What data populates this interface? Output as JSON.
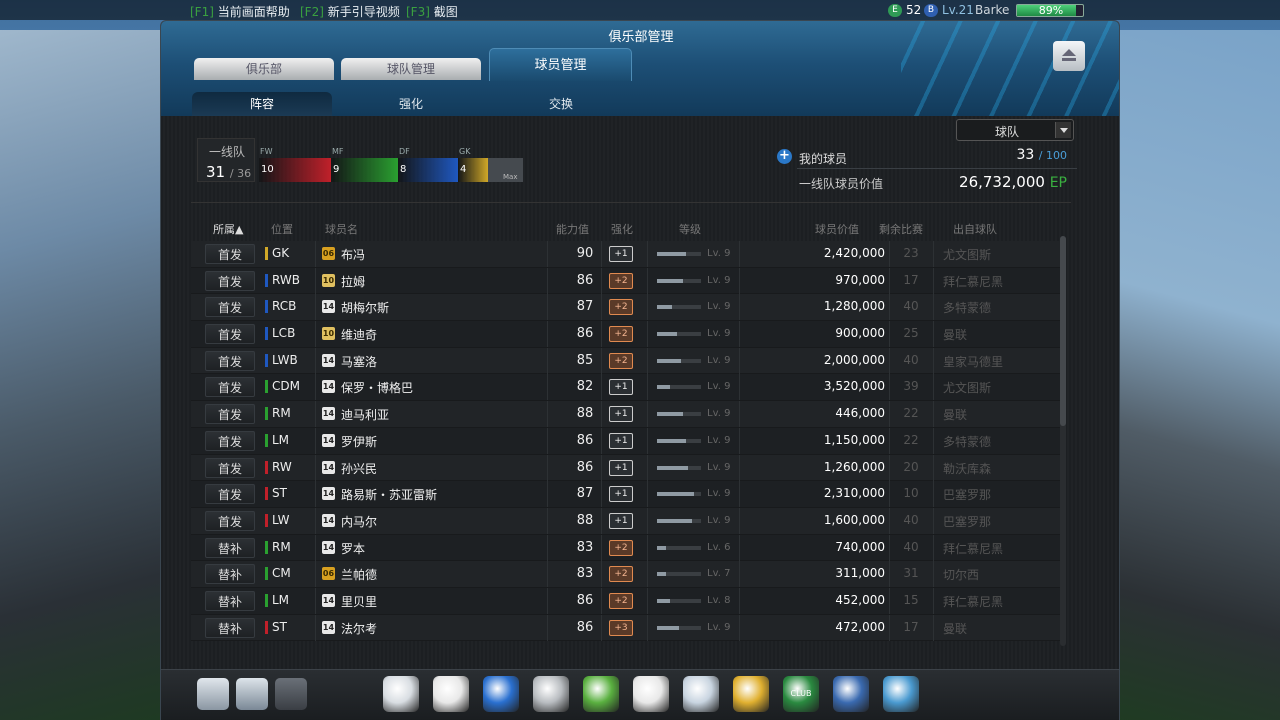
{
  "topbar": {
    "hotkeys": [
      {
        "key": "[F1]",
        "label": "当前画面帮助"
      },
      {
        "key": "[F2]",
        "label": "新手引导视频"
      },
      {
        "key": "[F3]",
        "label": "截图"
      }
    ],
    "coins": "52",
    "level": "Lv.21",
    "username": "Barke",
    "battery": "89%",
    "battery_fraction": 0.89,
    "coin_icon_letter": "E",
    "badge_icon_letter": "B"
  },
  "window": {
    "title": "俱乐部管理",
    "tabs": [
      "俱乐部",
      "球队管理",
      "球员管理"
    ],
    "active_tab": "球员管理",
    "subtabs": [
      "阵容",
      "强化",
      "交换"
    ]
  },
  "filter": {
    "selected": "球队"
  },
  "squad": {
    "label": "一线队",
    "count": "31",
    "total": "/ 36",
    "positions": [
      {
        "name": "FW",
        "count": "10",
        "color": "#c0202a"
      },
      {
        "name": "MF",
        "count": "9",
        "color": "#2aa030"
      },
      {
        "name": "DF",
        "count": "8",
        "color": "#1f58c0"
      },
      {
        "name": "GK",
        "count": "4",
        "color": "#d0a828"
      }
    ],
    "max_label": "Max"
  },
  "my_players": {
    "label": "我的球员",
    "count": "33",
    "capacity": "/ 100",
    "value_label": "一线队球员价值",
    "value": "26,732,000",
    "currency": "EP"
  },
  "table": {
    "headers": {
      "affiliation": "所属▲",
      "position": "位置",
      "name": "球员名",
      "ability": "能力值",
      "enhance": "强化",
      "grade": "等级",
      "value": "球员价值",
      "remaining": "剩余比赛",
      "club": "出自球队"
    },
    "rows": [
      {
        "status": "首发",
        "pos": "GK",
        "color": "#d0a828",
        "season": "06",
        "name": "布冯",
        "ability": "90",
        "enh": "+1",
        "lvl": "Lv. 9",
        "lvp": 0.65,
        "price": "2,420,000",
        "remaining": "23",
        "club": "尤文图斯"
      },
      {
        "status": "首发",
        "pos": "RWB",
        "color": "#1f58c0",
        "season": "10",
        "name": "拉姆",
        "ability": "86",
        "enh": "+2",
        "lvl": "Lv. 9",
        "lvp": 0.6,
        "price": "970,000",
        "remaining": "17",
        "club": "拜仁慕尼黑"
      },
      {
        "status": "首发",
        "pos": "RCB",
        "color": "#1f58c0",
        "season": "14",
        "name": "胡梅尔斯",
        "ability": "87",
        "enh": "+2",
        "lvl": "Lv. 9",
        "lvp": 0.35,
        "price": "1,280,000",
        "remaining": "40",
        "club": "多特蒙德"
      },
      {
        "status": "首发",
        "pos": "LCB",
        "color": "#1f58c0",
        "season": "10",
        "name": "维迪奇",
        "ability": "86",
        "enh": "+2",
        "lvl": "Lv. 9",
        "lvp": 0.45,
        "price": "900,000",
        "remaining": "25",
        "club": "曼联"
      },
      {
        "status": "首发",
        "pos": "LWB",
        "color": "#1f58c0",
        "season": "14",
        "name": "马塞洛",
        "ability": "85",
        "enh": "+2",
        "lvl": "Lv. 9",
        "lvp": 0.55,
        "price": "2,000,000",
        "remaining": "40",
        "club": "皇家马德里"
      },
      {
        "status": "首发",
        "pos": "CDM",
        "color": "#2aa030",
        "season": "14",
        "name": "保罗・博格巴",
        "ability": "82",
        "enh": "+1",
        "lvl": "Lv. 9",
        "lvp": 0.3,
        "price": "3,520,000",
        "remaining": "39",
        "club": "尤文图斯"
      },
      {
        "status": "首发",
        "pos": "RM",
        "color": "#2aa030",
        "season": "14",
        "name": "迪马利亚",
        "ability": "88",
        "enh": "+1",
        "lvl": "Lv. 9",
        "lvp": 0.6,
        "price": "446,000",
        "remaining": "22",
        "club": "曼联"
      },
      {
        "status": "首发",
        "pos": "LM",
        "color": "#2aa030",
        "season": "14",
        "name": "罗伊斯",
        "ability": "86",
        "enh": "+1",
        "lvl": "Lv. 9",
        "lvp": 0.65,
        "price": "1,150,000",
        "remaining": "22",
        "club": "多特蒙德"
      },
      {
        "status": "首发",
        "pos": "RW",
        "color": "#c0202a",
        "season": "14",
        "name": "孙兴民",
        "ability": "86",
        "enh": "+1",
        "lvl": "Lv. 9",
        "lvp": 0.7,
        "price": "1,260,000",
        "remaining": "20",
        "club": "勒沃库森"
      },
      {
        "status": "首发",
        "pos": "ST",
        "color": "#c0202a",
        "season": "14",
        "name": "路易斯・苏亚雷斯",
        "ability": "87",
        "enh": "+1",
        "lvl": "Lv. 9",
        "lvp": 0.85,
        "price": "2,310,000",
        "remaining": "10",
        "club": "巴塞罗那"
      },
      {
        "status": "首发",
        "pos": "LW",
        "color": "#c0202a",
        "season": "14",
        "name": "内马尔",
        "ability": "88",
        "enh": "+1",
        "lvl": "Lv. 9",
        "lvp": 0.8,
        "price": "1,600,000",
        "remaining": "40",
        "club": "巴塞罗那"
      },
      {
        "status": "替补",
        "pos": "RM",
        "color": "#2aa030",
        "season": "14",
        "name": "罗本",
        "ability": "83",
        "enh": "+2",
        "lvl": "Lv. 6",
        "lvp": 0.2,
        "price": "740,000",
        "remaining": "40",
        "club": "拜仁慕尼黑"
      },
      {
        "status": "替补",
        "pos": "CM",
        "color": "#2aa030",
        "season": "06",
        "name": "兰帕德",
        "ability": "83",
        "enh": "+2",
        "lvl": "Lv. 7",
        "lvp": 0.2,
        "price": "311,000",
        "remaining": "31",
        "club": "切尔西"
      },
      {
        "status": "替补",
        "pos": "LM",
        "color": "#2aa030",
        "season": "14",
        "name": "里贝里",
        "ability": "86",
        "enh": "+2",
        "lvl": "Lv. 8",
        "lvp": 0.3,
        "price": "452,000",
        "remaining": "15",
        "club": "拜仁慕尼黑"
      },
      {
        "status": "替补",
        "pos": "ST",
        "color": "#c0202a",
        "season": "14",
        "name": "法尔考",
        "ability": "86",
        "enh": "+3",
        "lvl": "Lv. 9",
        "lvp": 0.5,
        "price": "472,000",
        "remaining": "17",
        "club": "曼联"
      }
    ]
  },
  "bottom": {
    "left_icons": [
      "profile-icon",
      "message-icon",
      "mail-icon"
    ],
    "dock_icons": [
      "whistle-icon",
      "ball-icon",
      "boot-icon",
      "trophy-icon",
      "formation-icon",
      "kit-icon",
      "notepad-icon",
      "jersey-icon",
      "club-icon",
      "transfer-icon",
      "cart-icon"
    ],
    "club_label": "CLUB"
  }
}
